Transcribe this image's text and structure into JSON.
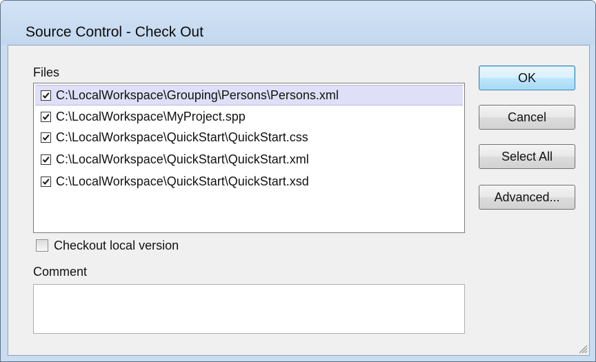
{
  "window": {
    "title": "Source Control - Check Out"
  },
  "files": {
    "label": "Files",
    "items": [
      {
        "path": "C:\\LocalWorkspace\\Grouping\\Persons\\Persons.xml",
        "checked": true,
        "selected": true
      },
      {
        "path": "C:\\LocalWorkspace\\MyProject.spp",
        "checked": true,
        "selected": false
      },
      {
        "path": "C:\\LocalWorkspace\\QuickStart\\QuickStart.css",
        "checked": true,
        "selected": false
      },
      {
        "path": "C:\\LocalWorkspace\\QuickStart\\QuickStart.xml",
        "checked": true,
        "selected": false
      },
      {
        "path": "C:\\LocalWorkspace\\QuickStart\\QuickStart.xsd",
        "checked": true,
        "selected": false
      }
    ]
  },
  "checkout_local": {
    "label": "Checkout local version",
    "checked": false
  },
  "comment": {
    "label": "Comment",
    "value": ""
  },
  "buttons": {
    "ok": "OK",
    "cancel": "Cancel",
    "select_all": "Select All",
    "advanced": "Advanced..."
  },
  "colors": {
    "title_bar": "#c9dcf0",
    "dialog_bg": "#f0f0f0",
    "selected_row": "#dfe0f7",
    "default_button": "#bee6fd"
  }
}
